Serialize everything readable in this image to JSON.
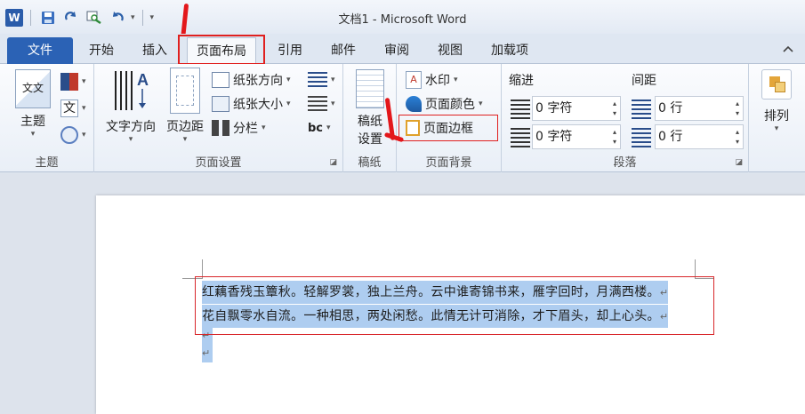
{
  "window": {
    "title": "文档1 - Microsoft Word",
    "app_icon": "W"
  },
  "qat": {
    "icons": [
      "word-icon",
      "save-icon",
      "redo-icon",
      "print-preview-icon",
      "undo-icon",
      "customize-icon"
    ],
    "undo_caret": "▾",
    "customize_glyph": "▾"
  },
  "tabs": [
    {
      "label": "文件"
    },
    {
      "label": "开始"
    },
    {
      "label": "插入"
    },
    {
      "label": "页面布局",
      "active": true
    },
    {
      "label": "引用"
    },
    {
      "label": "邮件"
    },
    {
      "label": "审阅"
    },
    {
      "label": "视图"
    },
    {
      "label": "加载项"
    }
  ],
  "ribbon": {
    "theme_group": {
      "label": "主题",
      "theme_button": "主题",
      "theme_icon_text": "文文",
      "fonts_icon_text": "文"
    },
    "page_setup_group": {
      "label": "页面设置",
      "text_direction": "文字方向",
      "margins": "页边距",
      "orientation": "纸张方向",
      "size": "纸张大小",
      "columns": "分栏"
    },
    "draft_group": {
      "label": "稿纸",
      "draft_settings_line1": "稿纸",
      "draft_settings_line2": "设置"
    },
    "page_background_group": {
      "label": "页面背景",
      "watermark": "水印",
      "page_color": "页面颜色",
      "page_borders": "页面边框"
    },
    "paragraph_group": {
      "label": "段落",
      "indent_label": "缩进",
      "indent_left": "0 字符",
      "indent_right": "0 字符",
      "spacing_label": "间距",
      "spacing_before": "0 行",
      "spacing_after": "0 行"
    },
    "arrange_group": {
      "arrange": "排列"
    }
  },
  "document": {
    "lines": [
      "红藕香残玉簟秋。轻解罗裳，独上兰舟。云中谁寄锦书来，雁字回时，月满西楼。",
      "花自飘零水自流。一种相思，两处闲愁。此情无计可消除，才下眉头，却上心头。"
    ],
    "paragraph_mark": "↵"
  },
  "colors": {
    "file_tab": "#2b62b5",
    "selection": "#aecdf0",
    "annotation_red": "#e3171b"
  }
}
